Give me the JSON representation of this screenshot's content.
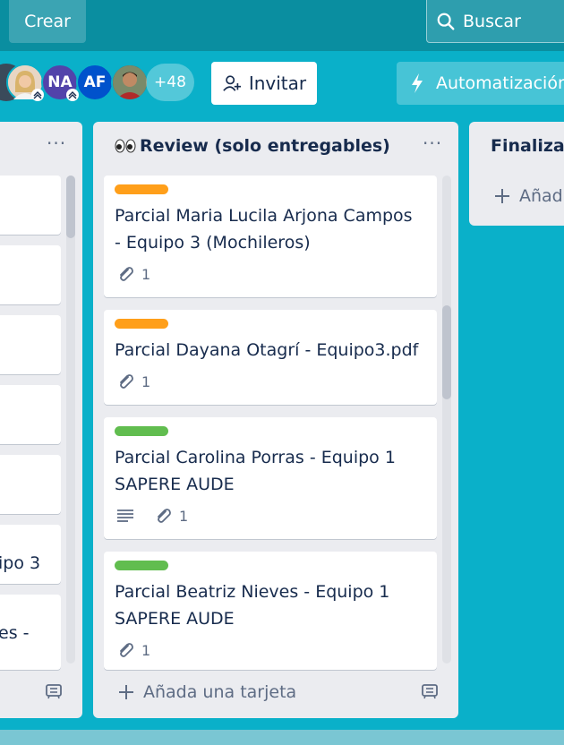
{
  "topbar": {
    "create_label": "Crear",
    "search_label": "Buscar"
  },
  "boardbar": {
    "members": [
      {
        "initials": "NA",
        "color": "#5243aa"
      },
      {
        "initials": "AF",
        "color": "#0052cc"
      }
    ],
    "more_members": "+48",
    "invite_label": "Invitar",
    "automation_label": "Automatización"
  },
  "left_list": {
    "menu": "···",
    "partial_texts": [
      "ipo 3",
      "es -"
    ]
  },
  "review_list": {
    "title": "Review (solo entregables)",
    "menu": "···",
    "cards": [
      {
        "label_color": "#ff9f1a",
        "title": "Parcial Maria Lucila Arjona Campos - Equipo 3 (Mochileros)",
        "attachments": "1",
        "has_description": false
      },
      {
        "label_color": "#ff9f1a",
        "title": "Parcial Dayana Otagrí - Equipo3.pdf",
        "attachments": "1",
        "has_description": false
      },
      {
        "label_color": "#61bd4f",
        "title": "Parcial Carolina Porras - Equipo 1 SAPERE AUDE",
        "attachments": "1",
        "has_description": true
      },
      {
        "label_color": "#61bd4f",
        "title": "Parcial Beatriz Nieves - Equipo 1 SAPERE AUDE",
        "attachments": "1",
        "has_description": false
      }
    ],
    "add_card_label": "Añada una tarjeta"
  },
  "done_list": {
    "title": "Finalizad",
    "add_label": "Añad"
  }
}
